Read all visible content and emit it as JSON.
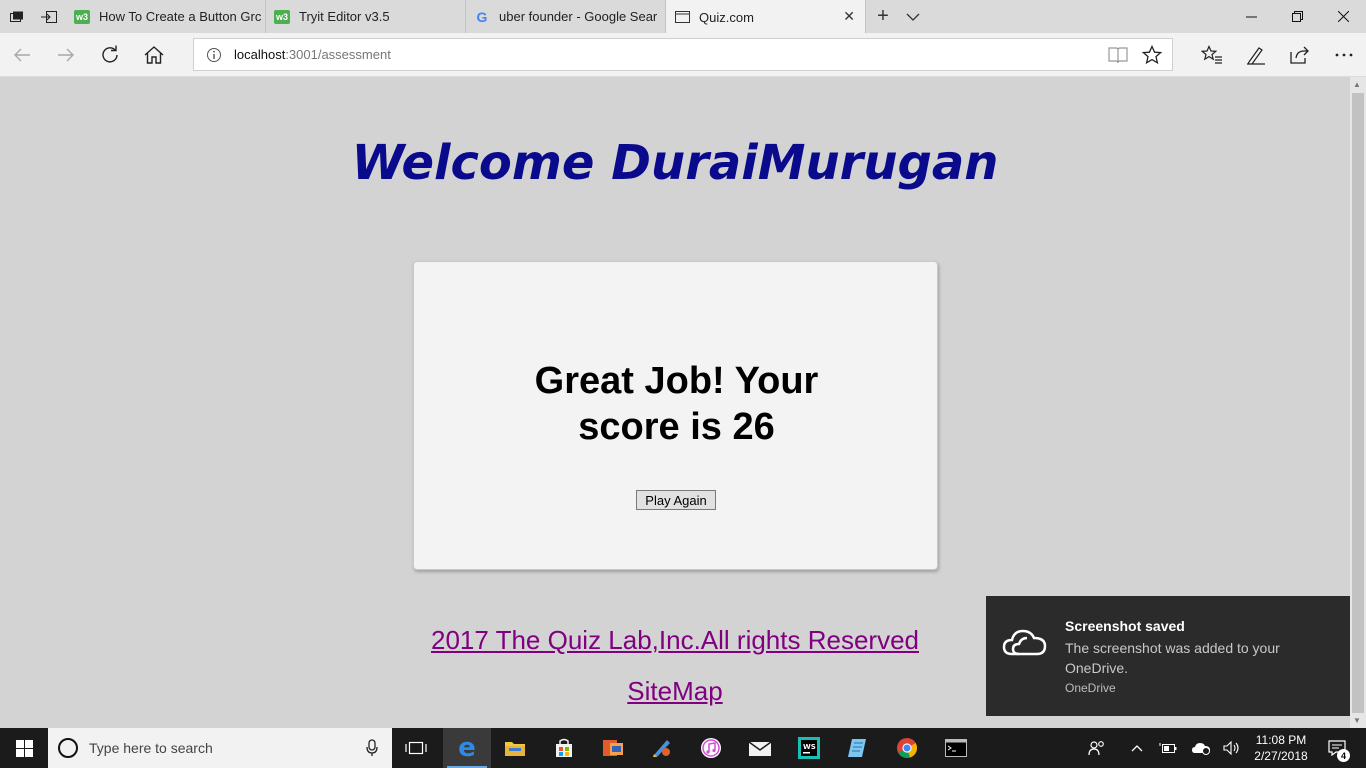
{
  "browser": {
    "tabs": [
      {
        "title": "How To Create a Button Grc",
        "favicon": "w3schools-icon"
      },
      {
        "title": "Tryit Editor v3.5",
        "favicon": "w3schools-icon"
      },
      {
        "title": "uber founder - Google Sear",
        "favicon": "google-icon"
      },
      {
        "title": "Quiz.com",
        "favicon": "page-icon",
        "active": true
      }
    ],
    "address": {
      "host": "localhost",
      "path": ":3001/assessment"
    }
  },
  "page": {
    "welcome": "Welcome DuraiMurugan",
    "score_text": "Great Job! Your score is 26",
    "play_again": "Play Again",
    "copyright": "2017 The Quiz Lab,Inc.All rights Reserved",
    "sitemap": "SiteMap"
  },
  "toast": {
    "title": "Screenshot saved",
    "body": "The screenshot was added to your OneDrive.",
    "source": "OneDrive"
  },
  "taskbar": {
    "search_placeholder": "Type here to search",
    "time": "11:08 PM",
    "date": "2/27/2018",
    "notification_count": "4"
  },
  "colors": {
    "welcome": "#0a0a8c",
    "link_visited": "#800080",
    "page_bg": "#d3d3d3",
    "card_bg": "#f3f3f3"
  }
}
